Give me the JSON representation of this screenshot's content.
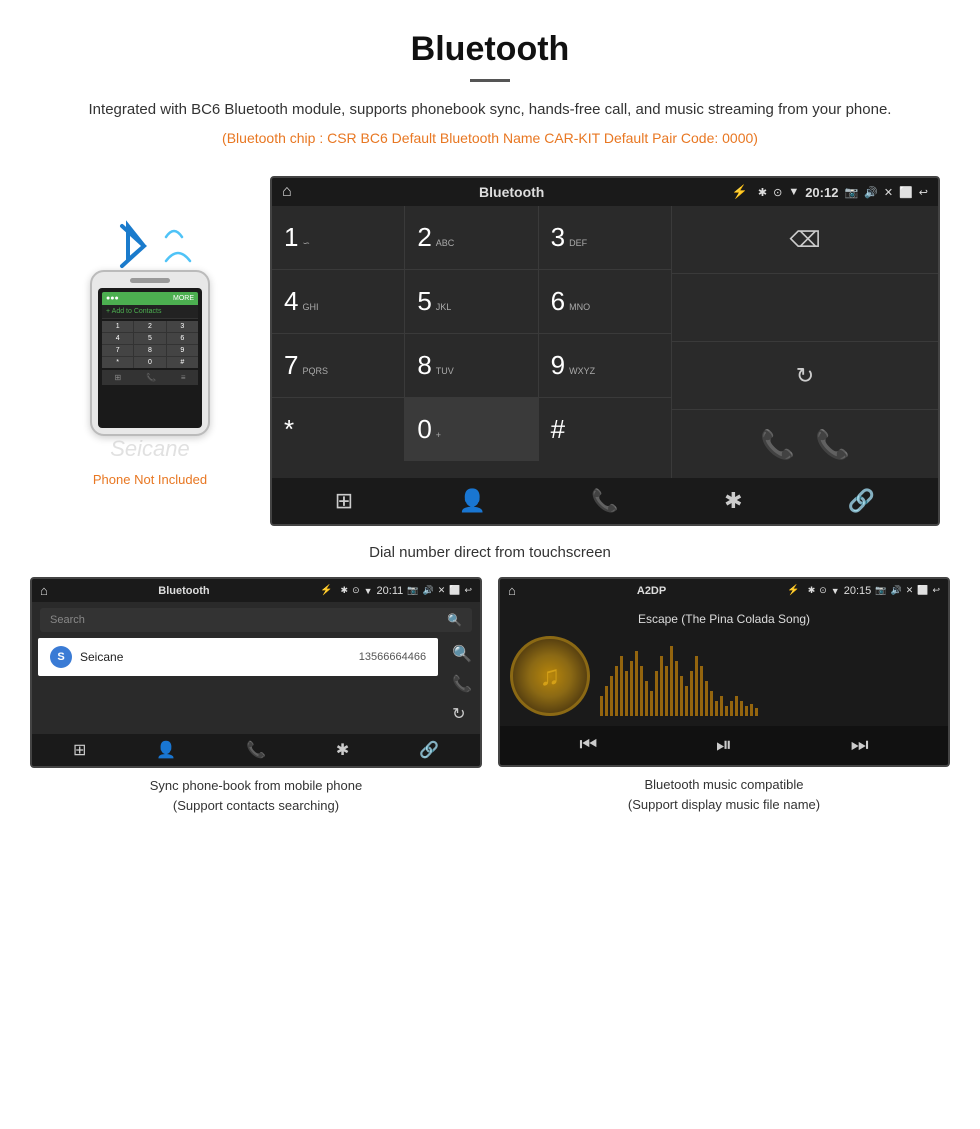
{
  "header": {
    "title": "Bluetooth",
    "description": "Integrated with BC6 Bluetooth module, supports phonebook sync, hands-free call, and music streaming from your phone.",
    "specs": "(Bluetooth chip : CSR BC6    Default Bluetooth Name CAR-KIT    Default Pair Code: 0000)"
  },
  "main_screen": {
    "status_bar": {
      "title": "Bluetooth",
      "time": "20:12",
      "icons": "✱ ⊙ ▼ 🔔"
    },
    "dialpad": {
      "keys": [
        {
          "num": "1",
          "alpha": "∽"
        },
        {
          "num": "2",
          "alpha": "ABC"
        },
        {
          "num": "3",
          "alpha": "DEF"
        },
        {
          "num": "4",
          "alpha": "GHI"
        },
        {
          "num": "5",
          "alpha": "JKL"
        },
        {
          "num": "6",
          "alpha": "MNO"
        },
        {
          "num": "7",
          "alpha": "PQRS"
        },
        {
          "num": "8",
          "alpha": "TUV"
        },
        {
          "num": "9",
          "alpha": "WXYZ"
        },
        {
          "num": "*",
          "alpha": ""
        },
        {
          "num": "0",
          "alpha": "+"
        },
        {
          "num": "#",
          "alpha": ""
        }
      ]
    },
    "caption": "Dial number direct from touchscreen"
  },
  "phonebook_screen": {
    "status_bar": {
      "title": "Bluetooth",
      "time": "20:11"
    },
    "search_placeholder": "Search",
    "contacts": [
      {
        "initial": "S",
        "name": "Seicane",
        "number": "13566664466"
      }
    ],
    "caption_line1": "Sync phone-book from mobile phone",
    "caption_line2": "(Support contacts searching)"
  },
  "music_screen": {
    "status_bar": {
      "title": "A2DP",
      "time": "20:15"
    },
    "song_title": "Escape (The Pina Colada Song)",
    "caption_line1": "Bluetooth music compatible",
    "caption_line2": "(Support display music file name)"
  },
  "phone_not_included": "Phone Not Included",
  "watermark": "Seicane"
}
